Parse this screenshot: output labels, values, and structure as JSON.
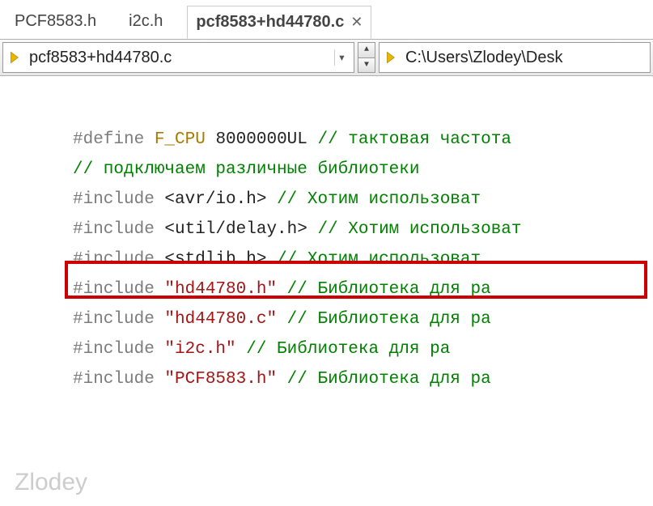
{
  "tabs": {
    "t0": "PCF8583.h",
    "t1": "i2c.h",
    "t2": "pcf8583+hd44780.c"
  },
  "toolbar": {
    "file_combo": "pcf8583+hd44780.c",
    "path_combo": "C:\\Users\\Zlodey\\Desk"
  },
  "code": {
    "l0": {
      "a": "#define ",
      "b": "F_CPU ",
      "c": "8000000UL ",
      "d": "// тактовая частота "
    },
    "l1": {
      "a": "// подключаем различные библиотеки"
    },
    "l2": {
      "a": "#include ",
      "b": "<avr/io.h>",
      "pad": "      ",
      "c": "// Хотим использоват"
    },
    "l3": {
      "a": "#include ",
      "b": "<util/delay.h>",
      "pad": " ",
      "c": "// Хотим использоват"
    },
    "l4": {
      "a": "#include ",
      "b": "<stdlib.h>",
      "pad": "      ",
      "c": "// Хотим использоват"
    },
    "l5": {
      "a": "#include ",
      "b": "\"hd44780.h\"",
      "pad": "     ",
      "c": "// Библиотека для ра"
    },
    "l6": {
      "a": "#include ",
      "b": "\"hd44780.c\"",
      "pad": "     ",
      "c": "// Библиотека для ра"
    },
    "l7": {
      "a": "#include ",
      "b": "\"i2c.h\"",
      "pad": "         ",
      "c": "// Библиотека для ра"
    },
    "l8": {
      "a": "#include ",
      "b": "\"PCF8583.h\"",
      "pad": "     ",
      "c": "// Библиотека для ра"
    }
  },
  "watermark": "Zlodey"
}
